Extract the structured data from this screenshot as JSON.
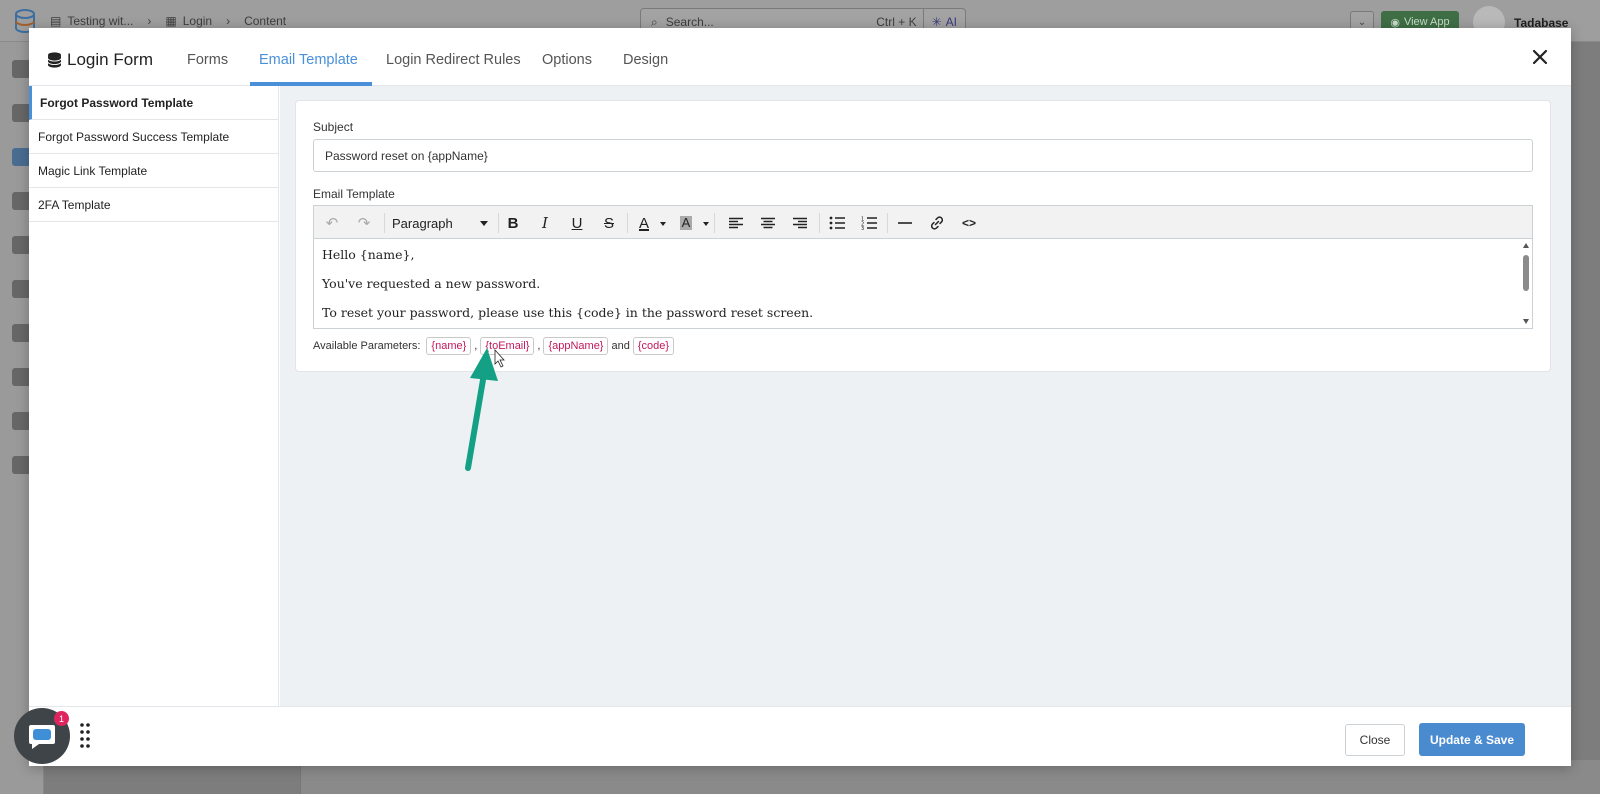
{
  "background": {
    "breadcrumb": [
      "Testing wit...",
      "Login",
      "Content"
    ],
    "search_placeholder": "Search...",
    "search_shortcut": "Ctrl + K",
    "ai_label": "AI",
    "view_app": "View App",
    "username": "Tadabase"
  },
  "modal": {
    "title": "Login Form",
    "tabs": [
      "Forms",
      "Email Template",
      "Login Redirect Rules",
      "Options",
      "Design"
    ],
    "active_tab": "Email Template",
    "left_items": [
      "Forgot Password Template",
      "Forgot Password Success Template",
      "Magic Link Template",
      "2FA Template"
    ],
    "subject_label": "Subject",
    "subject_value": "Password reset on {appName}",
    "email_template_label": "Email Template",
    "format_select": "Paragraph",
    "body_lines": [
      "Hello {name},",
      "You've requested a new password.",
      "To reset your password, please use this {code} in the password reset screen."
    ],
    "params_label": "Available Parameters:",
    "params": [
      "{name}",
      "{toEmail}",
      "{appName}",
      "{code}"
    ],
    "params_sep": ",",
    "params_and": "and",
    "close_button": "Close",
    "save_button": "Update & Save"
  },
  "chat": {
    "badge_count": "1"
  },
  "colors": {
    "accent": "#4a90d9",
    "param_text": "#c2185b",
    "arrow": "#14a085"
  }
}
